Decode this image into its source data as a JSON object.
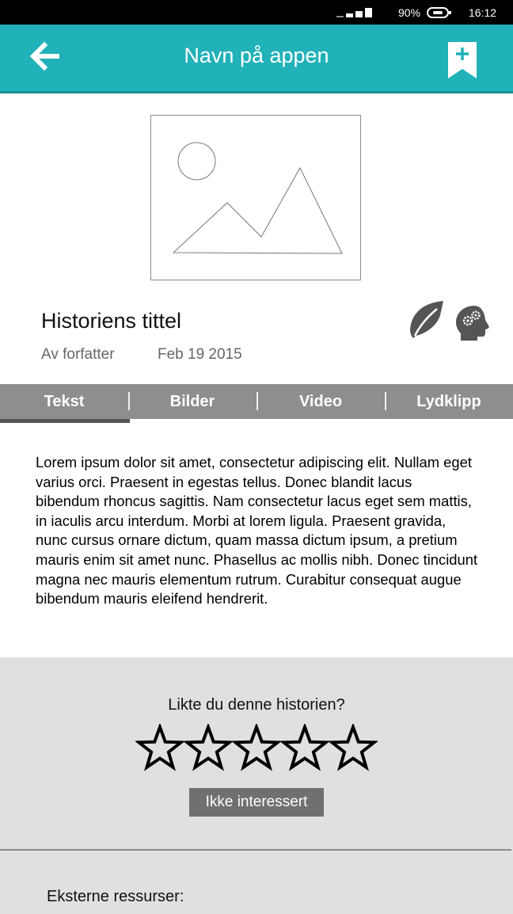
{
  "status_bar": {
    "battery": "90%",
    "time": "16:12"
  },
  "app_bar": {
    "title": "Navn på appen",
    "back_icon": "arrow-left-icon",
    "bookmark_icon": "bookmark-add-icon"
  },
  "story": {
    "image_icon": "image-placeholder-icon",
    "title": "Historiens tittel",
    "author": "Av forfatter",
    "date": "Feb 19 2015",
    "category_icons": [
      "leaf-icon",
      "head-gears-icon"
    ]
  },
  "tabs": [
    {
      "label": "Tekst",
      "active": true
    },
    {
      "label": "Bilder",
      "active": false
    },
    {
      "label": "Video",
      "active": false
    },
    {
      "label": "Lydklipp",
      "active": false
    }
  ],
  "content": {
    "text": "Lorem ipsum dolor sit amet, consectetur adipiscing elit. Nullam eget varius orci. Praesent in egestas tellus. Donec blandit lacus bibendum rhoncus sagittis. Nam consectetur lacus eget sem mattis, in iaculis arcu interdum. Morbi at lorem ligula. Praesent gravida, nunc cursus ornare dictum, quam massa dictum ipsum, a pretium mauris enim sit amet nunc. Phasellus ac mollis nibh. Donec tincidunt magna nec mauris elementum rutrum. Curabitur consequat augue bibendum mauris eleifend hendrerit."
  },
  "rating": {
    "question": "Likte du denne historien?",
    "stars_total": 5,
    "stars_selected": 0,
    "not_interested_label": "Ikke interessert"
  },
  "external": {
    "label": "Eksterne ressurser:"
  },
  "colors": {
    "accent": "#21b1b8",
    "tab_bar": "#8e8e8e",
    "panel": "#e0e0e0",
    "button": "#707070"
  }
}
